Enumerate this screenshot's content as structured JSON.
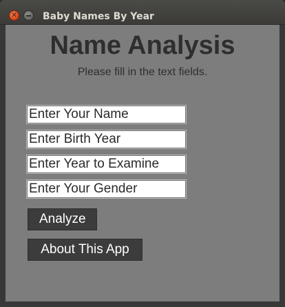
{
  "window": {
    "title": "Baby Names By Year",
    "close_icon": "close-icon",
    "minimize_icon": "minimize-icon"
  },
  "main": {
    "heading": "Name Analysis",
    "subheading": "Please fill in the text fields.",
    "fields": [
      {
        "name": "name-field",
        "placeholder": "Enter Your Name",
        "value": ""
      },
      {
        "name": "birth-year-field",
        "placeholder": "Enter Birth Year",
        "value": ""
      },
      {
        "name": "examine-year-field",
        "placeholder": "Enter Year to Examine",
        "value": ""
      },
      {
        "name": "gender-field",
        "placeholder": "Enter Your Gender",
        "value": ""
      }
    ],
    "buttons": {
      "analyze": "Analyze",
      "about": "About This App"
    }
  },
  "colors": {
    "content_background": "#7d7d7d",
    "button_background": "#3c3c3c",
    "close_button": "#df4a16",
    "titlebar": "#3c3b37"
  }
}
